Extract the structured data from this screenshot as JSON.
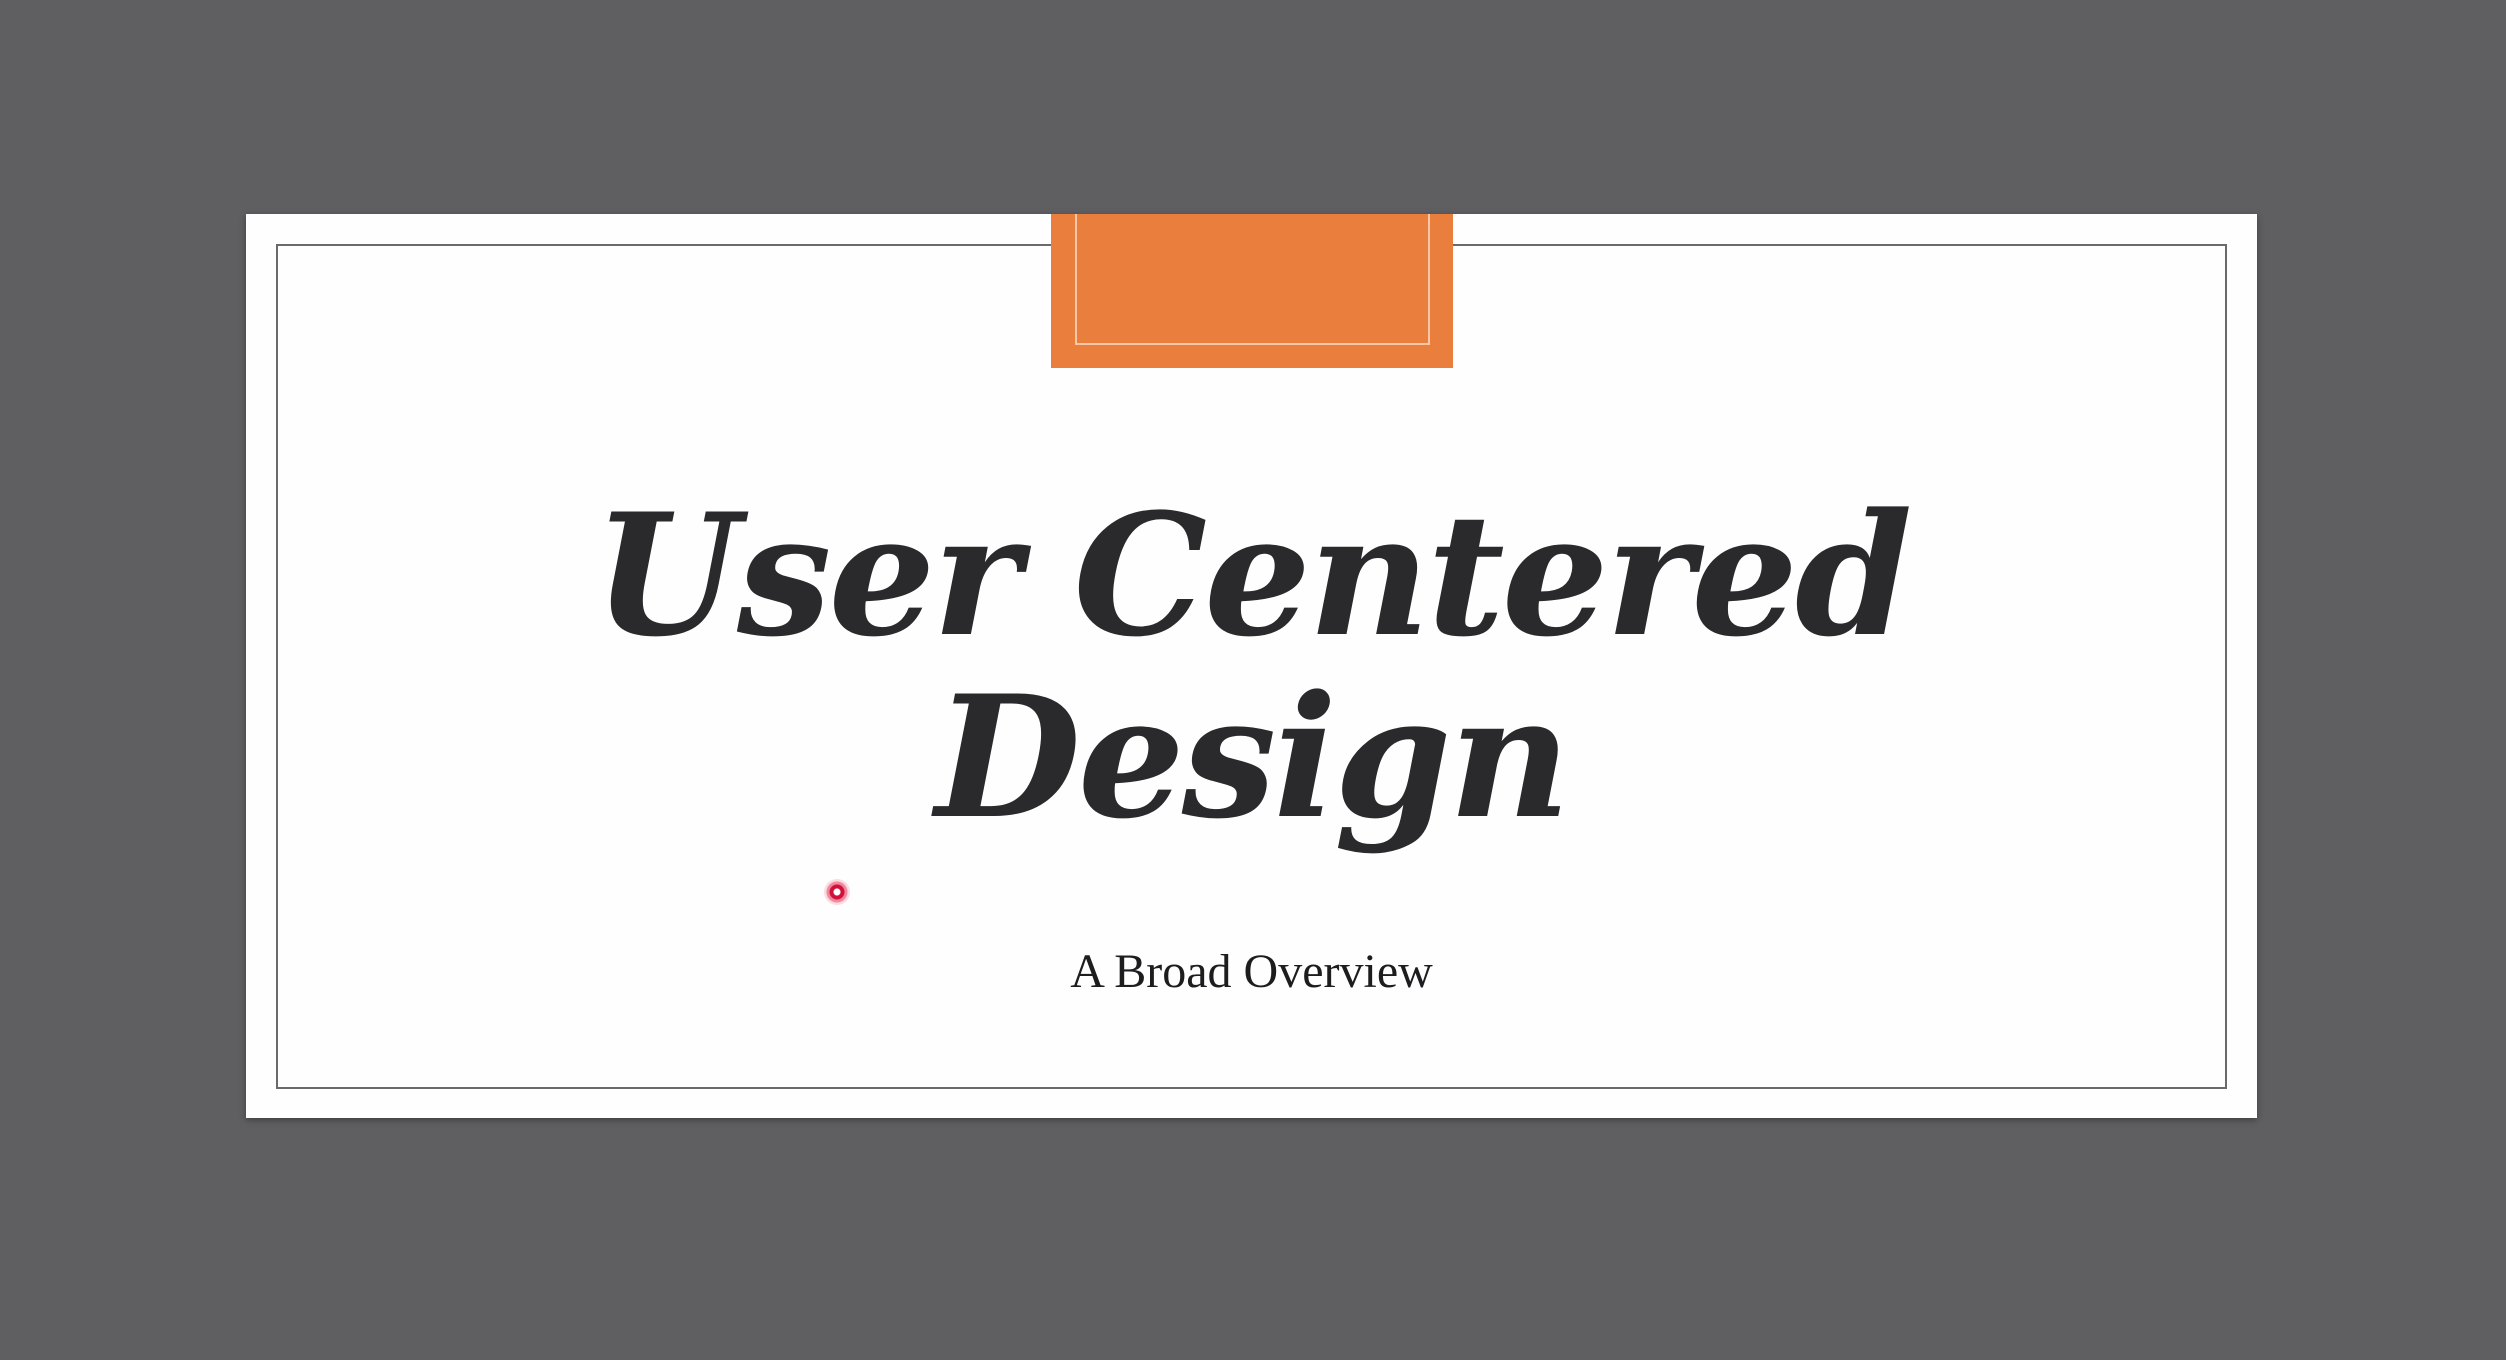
{
  "slide": {
    "title_line1": "User Centered",
    "title_line2": "Design",
    "subtitle": "A Broad Overview"
  },
  "colors": {
    "background": "#5f5e61",
    "slide": "#fefefe",
    "accent": "#ea7f3d",
    "title_text": "#2a2a2d",
    "pointer": "#d0103a"
  },
  "icons": {
    "pointer": "laser-pointer-icon"
  }
}
